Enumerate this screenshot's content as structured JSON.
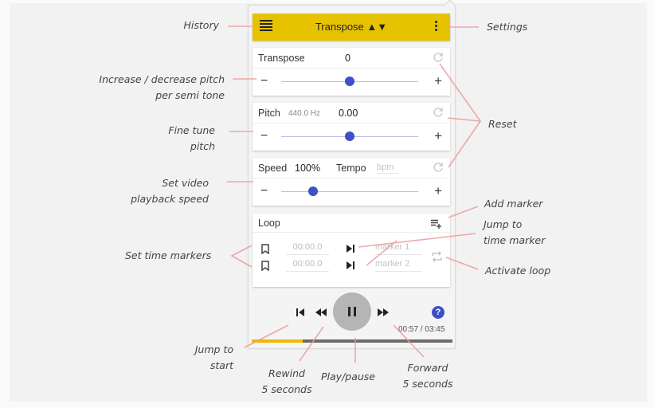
{
  "header": {
    "title": "Transpose ▲▼",
    "history_icon": "hamburger-menu-icon",
    "settings_icon": "vertical-dots-icon"
  },
  "transpose": {
    "label": "Transpose",
    "value": "0",
    "slider_fraction": 0.5
  },
  "pitch": {
    "label": "Pitch",
    "reference": "440.0 Hz",
    "value": "0.00",
    "slider_fraction": 0.5
  },
  "speed": {
    "label": "Speed",
    "value": "100%",
    "tempo_label": "Tempo",
    "tempo_placeholder": "bpm",
    "slider_fraction": 0.23
  },
  "loop": {
    "label": "Loop",
    "markers": [
      {
        "time": "00:00.0",
        "name_placeholder": "marker 1"
      },
      {
        "time": "00:00.0",
        "name_placeholder": "marker 2"
      }
    ]
  },
  "player": {
    "time_readout": "00:57 / 03:45",
    "progress_fraction": 0.253,
    "help_label": "?",
    "colors": {
      "accent": "#e6c200",
      "progress": "#f2b800",
      "slider": "#3f51c5",
      "help": "#3d4fc4"
    }
  },
  "annotations": {
    "history": "History",
    "settings": "Settings",
    "semitone": [
      "Increase / decrease pitch",
      "per semi tone"
    ],
    "fine_tune": [
      "Fine tune",
      "pitch"
    ],
    "reset": "Reset",
    "speed": [
      "Set video",
      "playback speed"
    ],
    "add_marker": "Add marker",
    "jump_marker": [
      "Jump to",
      "time marker"
    ],
    "time_markers": "Set time markers",
    "activate_loop": "Activate loop",
    "jump_start": [
      "Jump to",
      "start"
    ],
    "rewind": [
      "Rewind",
      "5 seconds"
    ],
    "play_pause": "Play/pause",
    "forward": [
      "Forward",
      "5 seconds"
    ]
  }
}
